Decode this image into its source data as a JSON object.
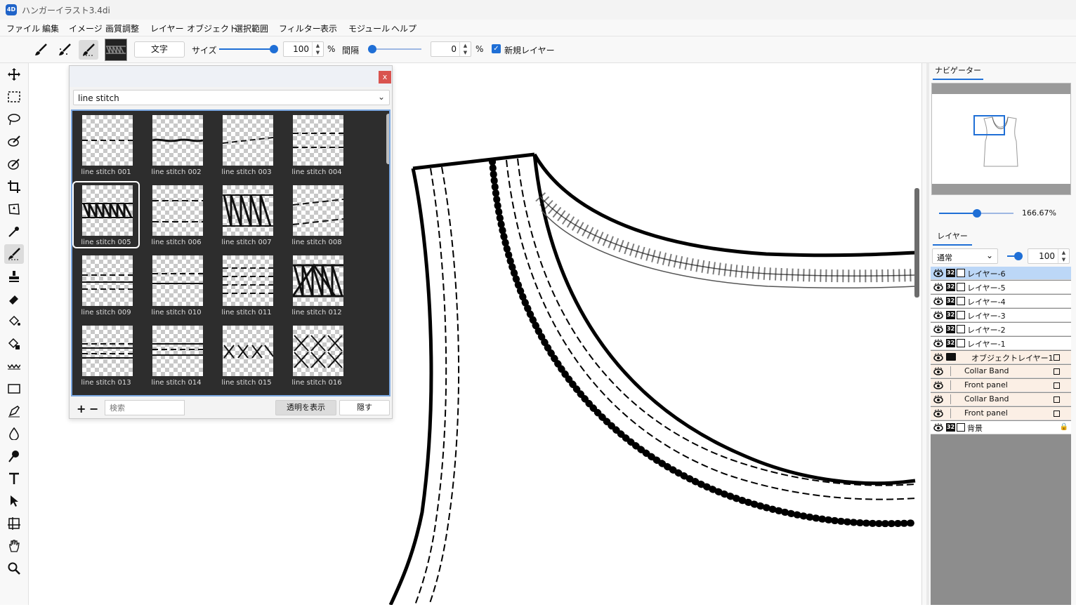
{
  "window": {
    "title": "ハンガーイラスト3.4di",
    "icon_text": "4D"
  },
  "menu": [
    "ファイル",
    "編集",
    "イメージ",
    "画質調整",
    "レイヤー",
    "オブジェクト",
    "選択範囲",
    "フィルター",
    "表示",
    "モジュール",
    "ヘルプ"
  ],
  "toolbar": {
    "text_button": "文字",
    "size_label": "サイズ",
    "size_value": "100",
    "size_unit": "%",
    "spacing_label": "間隔",
    "spacing_value": "0",
    "spacing_unit": "%",
    "new_layer_label": "新規レイヤー",
    "new_layer_checked": true
  },
  "brush_popup": {
    "category": "line stitch",
    "close_label": "x",
    "selected_index": 4,
    "items": [
      "line stitch 001",
      "line stitch 002",
      "line stitch 003",
      "line stitch 004",
      "line stitch 005",
      "line stitch 006",
      "line stitch 007",
      "line stitch 008",
      "line stitch 009",
      "line stitch 010",
      "line stitch 011",
      "line stitch 012",
      "line stitch 013",
      "line stitch 014",
      "line stitch 015",
      "line stitch 016"
    ],
    "add_label": "+",
    "remove_label": "−",
    "search_placeholder": "検索",
    "show_transparent_label": "透明を表示",
    "hide_label": "隠す"
  },
  "navigator": {
    "tab_label": "ナビゲーター",
    "zoom": "166.67%"
  },
  "layers_panel": {
    "tab_label": "レイヤー",
    "blend_mode": "通常",
    "opacity": "100",
    "layers": [
      {
        "name": "レイヤー-6",
        "kind": "pixel",
        "selected": true
      },
      {
        "name": "レイヤー-5",
        "kind": "pixel"
      },
      {
        "name": "レイヤー-4",
        "kind": "pixel"
      },
      {
        "name": "レイヤー-3",
        "kind": "pixel"
      },
      {
        "name": "レイヤー-2",
        "kind": "pixel"
      },
      {
        "name": "レイヤー-1",
        "kind": "pixel"
      },
      {
        "name": "オブジェクトレイヤー1",
        "kind": "folder"
      },
      {
        "name": "Collar Band",
        "kind": "object"
      },
      {
        "name": "Front panel",
        "kind": "object"
      },
      {
        "name": "Collar Band",
        "kind": "object"
      },
      {
        "name": "Front panel",
        "kind": "object"
      },
      {
        "name": "背景",
        "kind": "background",
        "locked": true
      }
    ],
    "badge": "32"
  },
  "colors": {
    "accent": "#1f6fd6",
    "close": "#d9534f",
    "selected_layer": "#bcd7f7",
    "object_layer": "#fbefe5"
  }
}
